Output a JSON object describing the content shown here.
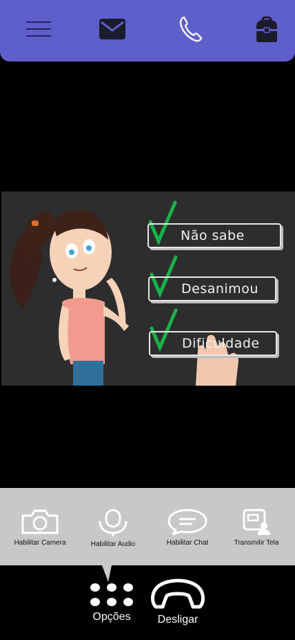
{
  "header": {
    "icons": [
      "menu-icon",
      "mail-icon",
      "phone-icon",
      "backpack-icon"
    ],
    "accent": "#5f5fcb"
  },
  "video": {
    "tags": [
      "Não sabe",
      "Desanimou",
      "Dificuldade"
    ]
  },
  "options_panel": {
    "items": [
      {
        "label": "Habilitar Camera",
        "icon": "camera-icon"
      },
      {
        "label": "Habilitar Audio",
        "icon": "microphone-icon"
      },
      {
        "label": "Habilitar Chat",
        "icon": "chat-icon"
      },
      {
        "label": "Transmitir Tela",
        "icon": "screen-share-icon"
      }
    ],
    "background": "#c8c8c8"
  },
  "bottom_bar": {
    "options_label": "Opções",
    "hangup_label": "Desligar"
  }
}
